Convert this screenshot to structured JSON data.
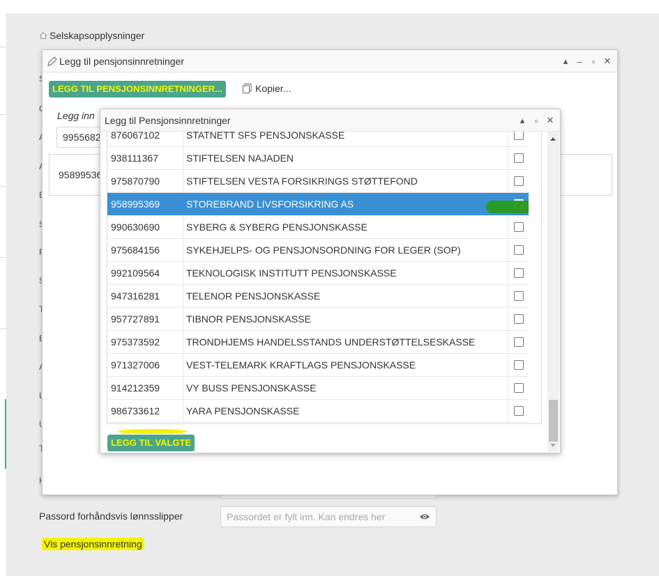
{
  "breadcrumb": {
    "label": "Selskapsopplysninger"
  },
  "side_letters": [
    "S",
    "O",
    "A",
    "A",
    "B",
    "S",
    "F",
    "S",
    "T",
    "E",
    "A",
    "L",
    "U",
    "T",
    "H"
  ],
  "password": {
    "label": "Passord forhåndsvis lønnsslipper",
    "placeholder": "Passordet er fylt inn. Kan endres her"
  },
  "vis_link": "Vis pensjonsinnretning",
  "outer_dialog": {
    "title": "Legg til pensjonsinnretninger",
    "add_button": "LEGG TIL PENSJONSINNRETNINGER...",
    "copy_label": "Kopier...",
    "legg_inn_label": "Legg inn",
    "input_value": "99556820",
    "panel_value": "958995369"
  },
  "inner_dialog": {
    "title": "Legg til Pensjonsinnretninger",
    "add_selected_button": "LEGG TIL VALGTE",
    "rows": [
      {
        "org_nr": "876067102",
        "name": "STATNETT SFS PENSJONSKASSE",
        "checked": false
      },
      {
        "org_nr": "938111367",
        "name": "STIFTELSEN NAJADEN",
        "checked": false
      },
      {
        "org_nr": "975870790",
        "name": "STIFTELSEN VESTA FORSIKRINGS STØTTEFOND",
        "checked": false
      },
      {
        "org_nr": "958995369",
        "name": "STOREBRAND LIVSFORSIKRING AS",
        "checked": true
      },
      {
        "org_nr": "990630690",
        "name": "SYBERG & SYBERG PENSJONSKASSE",
        "checked": false
      },
      {
        "org_nr": "975684156",
        "name": "SYKEHJELPS- OG PENSJONSORDNING FOR LEGER (SOP)",
        "checked": false
      },
      {
        "org_nr": "992109564",
        "name": "TEKNOLOGISK INSTITUTT PENSJONSKASSE",
        "checked": false
      },
      {
        "org_nr": "947316281",
        "name": "TELENOR PENSJONSKASSE",
        "checked": false
      },
      {
        "org_nr": "957727891",
        "name": "TIBNOR PENSJONSKASSE",
        "checked": false
      },
      {
        "org_nr": "975373592",
        "name": "TRONDHJEMS HANDELSSTANDS UNDERSTØTTELSESKASSE",
        "checked": false
      },
      {
        "org_nr": "971327006",
        "name": "VEST-TELEMARK KRAFTLAGS PENSJONSKASSE",
        "checked": false
      },
      {
        "org_nr": "914212359",
        "name": "VY BUSS PENSJONSKASSE",
        "checked": false
      },
      {
        "org_nr": "986733612",
        "name": "YARA PENSJONSKASSE",
        "checked": false
      }
    ]
  },
  "colors": {
    "button_bg": "#4aa58c",
    "highlight": "#f3f300",
    "selected_row": "#3a8fd4"
  }
}
